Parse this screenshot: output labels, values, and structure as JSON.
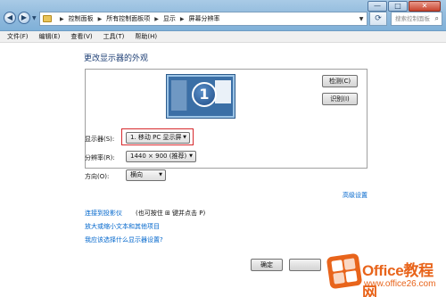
{
  "window": {
    "address": {
      "crumbs": [
        "控制面板",
        "所有控制面板项",
        "显示",
        "屏幕分辨率"
      ]
    },
    "search_placeholder": "搜索控制面板",
    "caption": {
      "minimize": "—",
      "maximize": "□",
      "close": "✕"
    }
  },
  "menubar": {
    "items": [
      "文件(F)",
      "编辑(E)",
      "查看(V)",
      "工具(T)",
      "帮助(H)"
    ]
  },
  "main": {
    "heading": "更改显示器的外观",
    "monitor_number": "1",
    "detect_label": "检测(C)",
    "identify_label": "识别(I)",
    "display_label": "显示器(S):",
    "display_value": "1. 移动 PC 显示屏",
    "resolution_label": "分辨率(R):",
    "resolution_value": "1440 × 900 (推荐)",
    "orientation_label": "方向(O):",
    "orientation_value": "横向",
    "advanced_link": "高级设置",
    "projector_link": "连接到投影仪",
    "projector_hint": "(也可按住 ⊞ 键并点击 P)",
    "text_size_link": "放大或缩小文本和其他项目",
    "which_settings_link": "我应该选择什么显示器设置?",
    "ok_label": "确定"
  },
  "watermark": {
    "title": "Office教程网",
    "url": "www.office26.com"
  },
  "colors": {
    "accent_link": "#0066cc",
    "heading": "#1e3f75",
    "highlight_box": "#d6282c",
    "watermark": "#e8641b"
  }
}
